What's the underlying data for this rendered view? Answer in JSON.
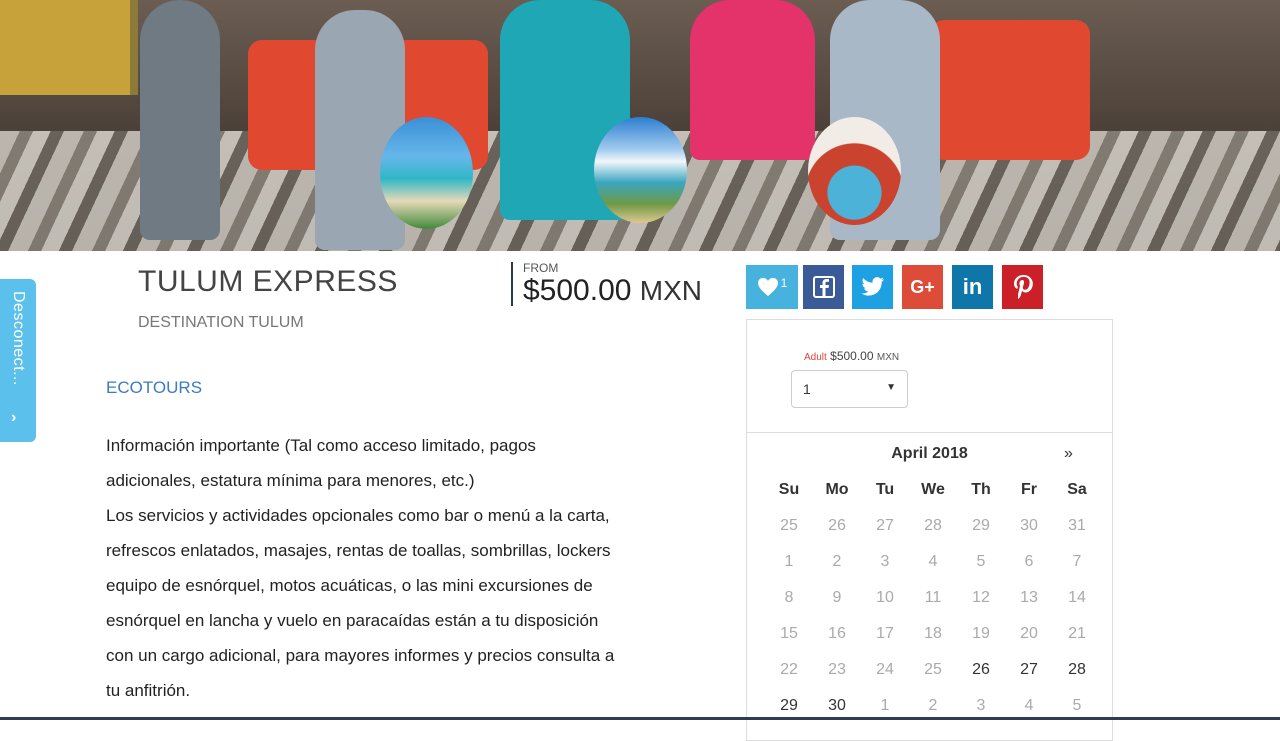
{
  "hero": {
    "alt": ""
  },
  "tour": {
    "title": "TULUM EXPRESS",
    "destination": "DESTINATION TULUM",
    "price_from_label": "FROM",
    "price": "$500.00",
    "currency": "MXN",
    "category": "ECOTOURS",
    "description": [
      "Información importante (Tal como acceso limitado, pagos adicionales, estatura mínima para menores, etc.)",
      "Los servicios y actividades opcionales como bar o menú a la carta, refrescos enlatados, masajes, rentas de toallas, sombrillas, lockers equipo de esnórquel, motos acuáticas, o las mini excursiones de esnórquel en lancha y vuelo en paracaídas están a tu disposición con un cargo adicional, para mayores informes y precios consulta a tu anfitrión."
    ]
  },
  "social": {
    "like_count": "1",
    "icons": [
      "heart-icon",
      "facebook-icon",
      "twitter-icon",
      "google-plus-icon",
      "linkedin-icon",
      "pinterest-icon"
    ],
    "colors": {
      "like": "#47b2de",
      "facebook": "#3a5a98",
      "twitter": "#1da1e2",
      "google_plus": "#dd4b39",
      "linkedin": "#0e76a8",
      "pinterest": "#cb2027"
    }
  },
  "side_tab": {
    "label": "Desconect..."
  },
  "booking": {
    "rate_label": "Adult",
    "rate_price": "$500.00",
    "rate_currency": "MXN",
    "quantity": "1",
    "calendar": {
      "month": "April 2018",
      "next": "»",
      "weekdays": [
        "Su",
        "Mo",
        "Tu",
        "We",
        "Th",
        "Fr",
        "Sa"
      ],
      "weeks": [
        [
          {
            "d": "25",
            "a": false
          },
          {
            "d": "26",
            "a": false
          },
          {
            "d": "27",
            "a": false
          },
          {
            "d": "28",
            "a": false
          },
          {
            "d": "29",
            "a": false
          },
          {
            "d": "30",
            "a": false
          },
          {
            "d": "31",
            "a": false
          }
        ],
        [
          {
            "d": "1",
            "a": false
          },
          {
            "d": "2",
            "a": false
          },
          {
            "d": "3",
            "a": false
          },
          {
            "d": "4",
            "a": false
          },
          {
            "d": "5",
            "a": false
          },
          {
            "d": "6",
            "a": false
          },
          {
            "d": "7",
            "a": false
          }
        ],
        [
          {
            "d": "8",
            "a": false
          },
          {
            "d": "9",
            "a": false
          },
          {
            "d": "10",
            "a": false
          },
          {
            "d": "11",
            "a": false
          },
          {
            "d": "12",
            "a": false
          },
          {
            "d": "13",
            "a": false
          },
          {
            "d": "14",
            "a": false
          }
        ],
        [
          {
            "d": "15",
            "a": false
          },
          {
            "d": "16",
            "a": false
          },
          {
            "d": "17",
            "a": false
          },
          {
            "d": "18",
            "a": false
          },
          {
            "d": "19",
            "a": false
          },
          {
            "d": "20",
            "a": false
          },
          {
            "d": "21",
            "a": false
          }
        ],
        [
          {
            "d": "22",
            "a": false
          },
          {
            "d": "23",
            "a": false
          },
          {
            "d": "24",
            "a": false
          },
          {
            "d": "25",
            "a": false
          },
          {
            "d": "26",
            "a": true
          },
          {
            "d": "27",
            "a": true
          },
          {
            "d": "28",
            "a": true
          }
        ],
        [
          {
            "d": "29",
            "a": true
          },
          {
            "d": "30",
            "a": true
          },
          {
            "d": "1",
            "a": false
          },
          {
            "d": "2",
            "a": false
          },
          {
            "d": "3",
            "a": false
          },
          {
            "d": "4",
            "a": false
          },
          {
            "d": "5",
            "a": false
          }
        ]
      ]
    }
  }
}
